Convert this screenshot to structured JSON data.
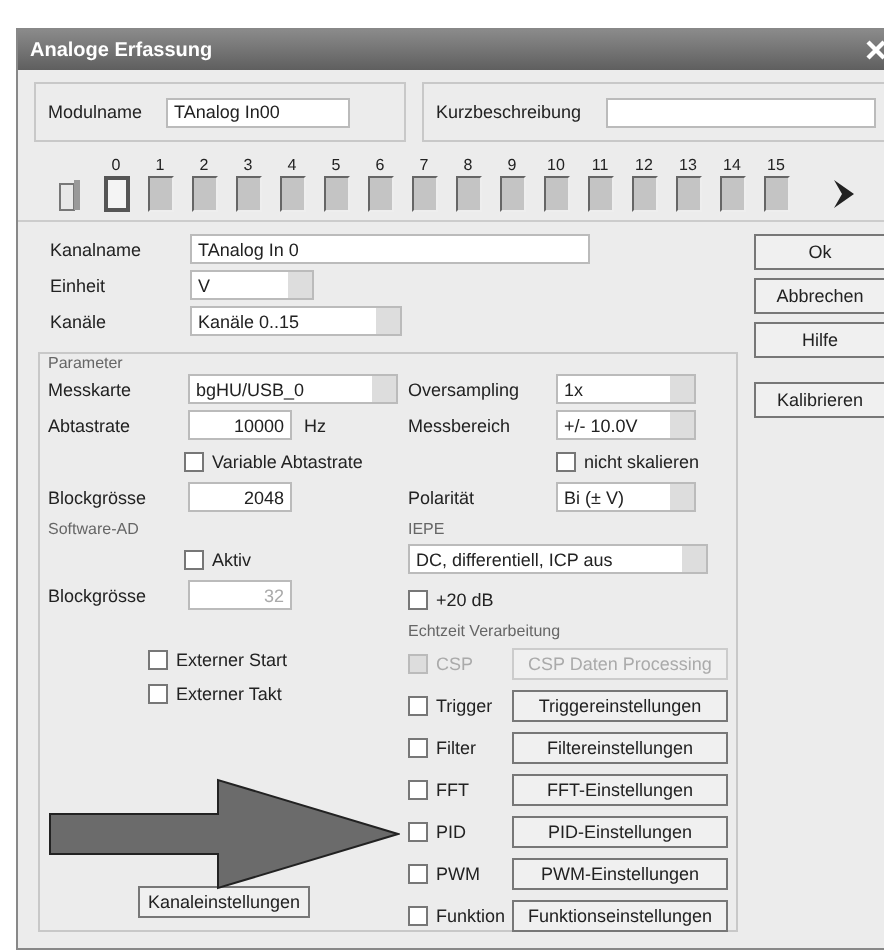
{
  "window": {
    "title": "Analoge Erfassung"
  },
  "module": {
    "name_label": "Modulname",
    "name_value": "TAnalog In00",
    "description_label": "Kurzbeschreibung"
  },
  "channels": [
    {
      "number": "0",
      "selected": true
    },
    {
      "number": "1",
      "selected": false
    },
    {
      "number": "2",
      "selected": false
    },
    {
      "number": "3",
      "selected": false
    },
    {
      "number": "4",
      "selected": false
    },
    {
      "number": "5",
      "selected": false
    },
    {
      "number": "6",
      "selected": false
    },
    {
      "number": "7",
      "selected": false
    },
    {
      "number": "8",
      "selected": false
    },
    {
      "number": "9",
      "selected": false
    },
    {
      "number": "10",
      "selected": false
    },
    {
      "number": "11",
      "selected": false
    },
    {
      "number": "12",
      "selected": false
    },
    {
      "number": "13",
      "selected": false
    },
    {
      "number": "14",
      "selected": false
    },
    {
      "number": "15",
      "selected": false
    }
  ],
  "channel_fields": [
    {
      "label": "Kanalname",
      "value": "TAnalog In 0",
      "kind": "text"
    },
    {
      "label": "Einheit",
      "value": "V",
      "kind": "combo"
    },
    {
      "label": "Kanäle",
      "value": "Kanäle 0..15",
      "kind": "combo"
    }
  ],
  "buttons": [
    {
      "label": "Ok"
    },
    {
      "label": "Abbrechen"
    },
    {
      "label": "Hilfe"
    },
    {
      "label": "Kalibrieren"
    }
  ],
  "parameter": {
    "title": "Parameter",
    "card_label": "Messkarte",
    "card_value": "bgHU/USB_0",
    "rate_label": "Abtastrate",
    "rate_value": "10000",
    "rate_unit": "Hz",
    "variable_rate": {
      "label": "Variable Abtastrate",
      "checked": false
    },
    "block_label": "Blockgrösse",
    "block_value": "2048",
    "software_title": "Software-AD",
    "software_active": {
      "label": "Aktiv",
      "checked": false
    },
    "software_block_label": "Blockgrösse",
    "software_block_value": "32",
    "external": [
      {
        "label": "Externer Start",
        "checked": false
      },
      {
        "label": "Externer Takt",
        "checked": false
      }
    ],
    "channel_settings_button": "Kanaleinstellungen",
    "oversampling_label": "Oversampling",
    "oversampling_value": "1x",
    "range_label": "Messbereich",
    "range_value": "+/- 10.0V",
    "no_scale": {
      "label": "nicht skalieren",
      "checked": false
    },
    "polarity_label": "Polarität",
    "polarity_value": "Bi (± V)",
    "iepe_title": "IEPE",
    "iepe_value": "DC, differentiell, ICP aus",
    "gain": {
      "label": "+20 dB",
      "checked": false
    },
    "realtime_title": "Echtzeit Verarbeitung",
    "realtime": [
      {
        "label": "CSP",
        "button": "CSP Daten Processing",
        "checked": false,
        "disabled": true
      },
      {
        "label": "Trigger",
        "button": "Triggereinstellungen",
        "checked": false,
        "disabled": false
      },
      {
        "label": "Filter",
        "button": "Filtereinstellungen",
        "checked": false,
        "disabled": false
      },
      {
        "label": "FFT",
        "button": "FFT-Einstellungen",
        "checked": false,
        "disabled": false
      },
      {
        "label": "PID",
        "button": "PID-Einstellungen",
        "checked": false,
        "disabled": false
      },
      {
        "label": "PWM",
        "button": "PWM-Einstellungen",
        "checked": false,
        "disabled": false
      },
      {
        "label": "Funktion",
        "button": "Funktionseinstellungen",
        "checked": false,
        "disabled": false
      }
    ]
  }
}
